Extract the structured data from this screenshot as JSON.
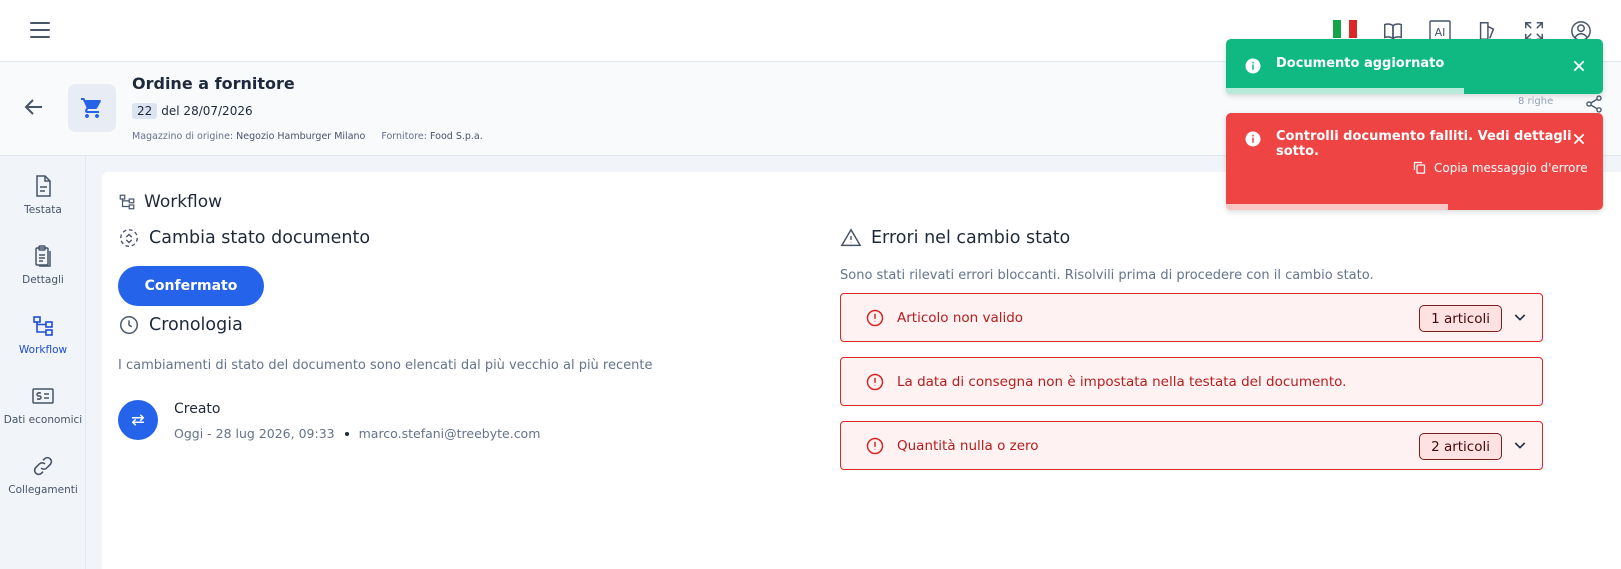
{
  "colors": {
    "primary": "#2563eb",
    "success": "#10b981",
    "error": "#ef4444",
    "error_text": "#b91c1c"
  },
  "topbar": {
    "icons": [
      "menu-icon",
      "italian-flag-icon",
      "book-icon",
      "ai-icon",
      "theme-icon",
      "fullscreen-icon",
      "account-icon"
    ],
    "ai_label": "AI"
  },
  "header": {
    "title": "Ordine a fornitore",
    "number": "22",
    "date_text": "del 28/07/2026",
    "warehouse_label": "Magazzino di origine:",
    "warehouse_value": "Negozio Hamburger Milano",
    "supplier_label": "Fornitore:",
    "supplier_value": "Food S.p.a.",
    "rows_count": "8 righe"
  },
  "sidebar": {
    "items": [
      {
        "label": "Testata",
        "icon": "document-icon"
      },
      {
        "label": "Dettagli",
        "icon": "clipboard-icon"
      },
      {
        "label": "Workflow",
        "icon": "workflow-icon",
        "active": true
      },
      {
        "label": "Dati economici",
        "icon": "money-icon"
      },
      {
        "label": "Collegamenti",
        "icon": "link-icon"
      }
    ]
  },
  "main": {
    "title": "Workflow",
    "change_state": {
      "title": "Cambia stato documento",
      "button_label": "Confermato"
    },
    "chronology": {
      "title": "Cronologia",
      "subtitle": "I cambiamenti di stato del documento sono elencati dal più vecchio al più recente",
      "entries": [
        {
          "title": "Creato",
          "datetime": "Oggi - 28 lug 2026, 09:33",
          "user": "marco.stefani@treebyte.com"
        }
      ]
    },
    "errors": {
      "title": "Errori nel cambio stato",
      "subtitle": "Sono stati rilevati errori bloccanti. Risolvili prima di procedere con il cambio stato.",
      "items": [
        {
          "text": "Articolo non valido",
          "badge": "1 articoli",
          "expandable": true
        },
        {
          "text": "La data di consegna non è impostata nella testata del documento.",
          "badge": "",
          "expandable": false
        },
        {
          "text": "Quantità nulla o zero",
          "badge": "2 articoli",
          "expandable": true
        }
      ]
    }
  },
  "toasts": [
    {
      "type": "success",
      "message": "Documento aggiornato",
      "progress": 0.63
    },
    {
      "type": "error",
      "message": "Controlli documento falliti. Vedi dettagli sotto.",
      "action": "Copia messaggio d'errore",
      "progress": 0.59
    }
  ]
}
